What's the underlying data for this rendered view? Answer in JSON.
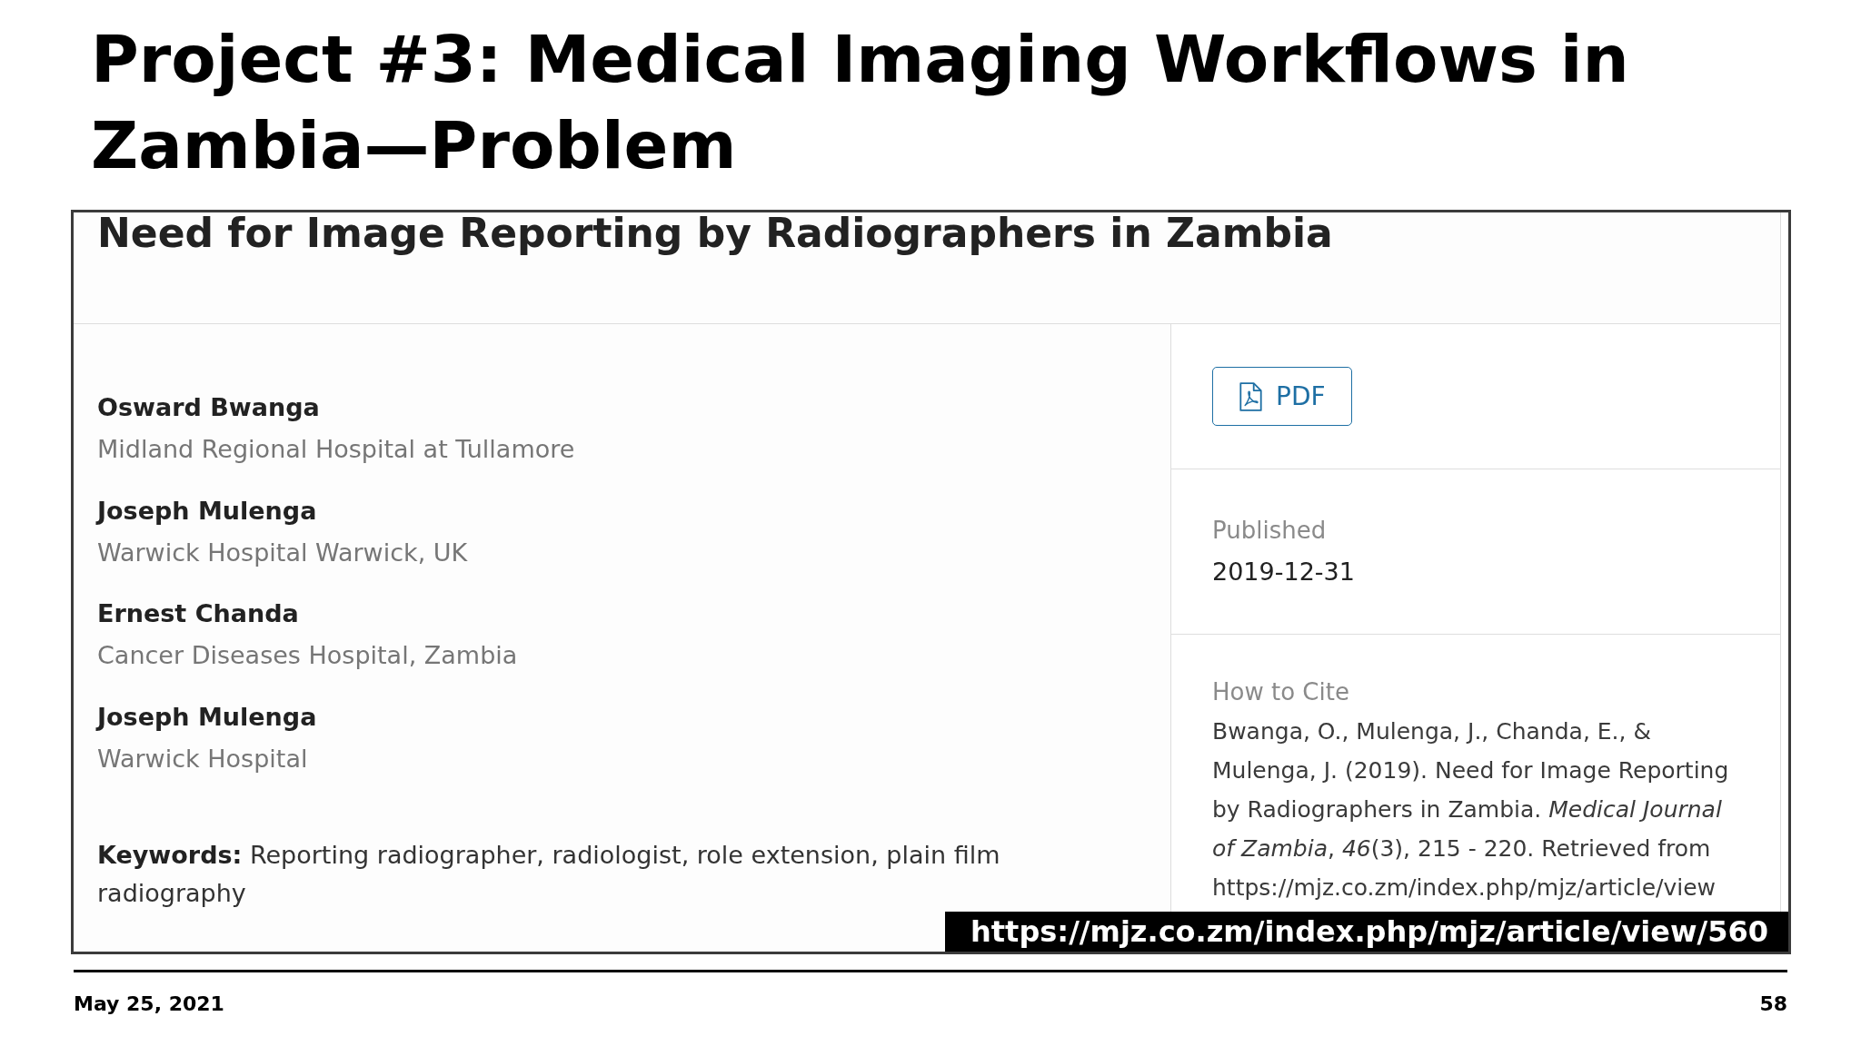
{
  "slide": {
    "title": "Project #3: Medical Imaging Workflows in Zambia—Problem"
  },
  "article": {
    "title": "Need for Image Reporting by Radiographers in Zambia",
    "authors": [
      {
        "name": "Osward Bwanga",
        "affiliation": "Midland Regional Hospital at Tullamore"
      },
      {
        "name": "Joseph Mulenga",
        "affiliation": "Warwick Hospital Warwick, UK"
      },
      {
        "name": "Ernest Chanda",
        "affiliation": "Cancer Diseases Hospital, Zambia"
      },
      {
        "name": "Joseph Mulenga",
        "affiliation": "Warwick Hospital"
      }
    ],
    "keywords": "**Keywords:** Reporting radiographer, radiologist, role extension, plain film radiography",
    "download_button": {
      "label": "PDF"
    },
    "published": {
      "label": "Published",
      "date": "2019-12-31"
    },
    "citation": {
      "label": "How to Cite",
      "text": "Bwanga, O., Mulenga, J., Chanda, E., & Mulenga, J. (2019). Need for Image Reporting by Radiographers in Zambia. *Medical Journal of Zambia*, *46*(3), 215 - 220. Retrieved from https://mjz.co.zm/index.php/mjz/article/view"
    }
  },
  "source_url": "https://mjz.co.zm/index.php/mjz/article/view/560",
  "footer": {
    "date": "May 25, 2021",
    "page_number": "58"
  }
}
